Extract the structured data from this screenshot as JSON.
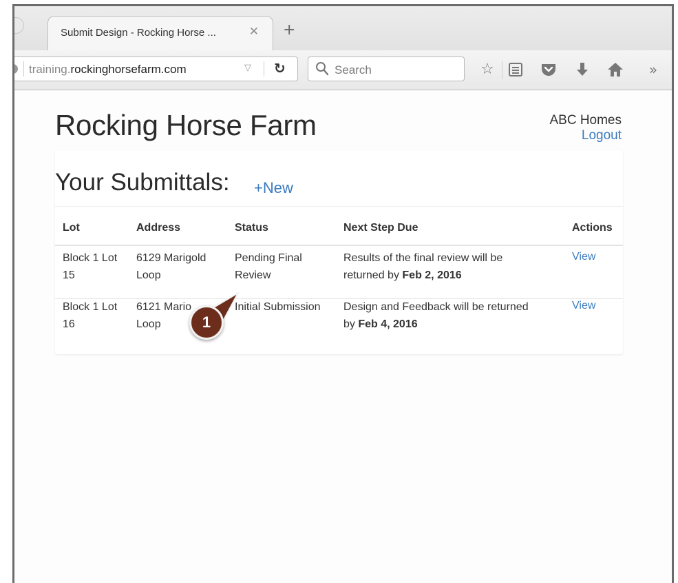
{
  "browser": {
    "tab_title": "Submit Design - Rocking Horse ...",
    "tab_close_glyph": "✕",
    "new_tab_glyph": "+",
    "url_prefix": "training.",
    "url_domain": "rockinghorsefarm.com",
    "search_placeholder": "Search",
    "toolbar_icons": [
      "bookmark-star-icon",
      "reading-list-icon",
      "pocket-icon",
      "download-icon",
      "home-icon",
      "overflow-chevron-icon"
    ]
  },
  "header": {
    "site_title": "Rocking Horse Farm",
    "user_name": "ABC Homes",
    "logout_label": "Logout"
  },
  "submittals": {
    "heading": "Your Submittals:",
    "new_label": "+New",
    "columns": [
      "Lot",
      "Address",
      "Status",
      "Next Step Due",
      "Actions"
    ],
    "rows": [
      {
        "lot_line1": "Block 1 Lot",
        "lot_line2": "15",
        "address_line1": "6129 Marigold",
        "address_line2": "Loop",
        "status_line1": "Pending Final",
        "status_line2": "Review",
        "next_step_line1": "Results of the final review will be",
        "next_step_line2_prefix": "returned by ",
        "next_step_date": "Feb 2, 2016",
        "action_label": "View"
      },
      {
        "lot_line1": "Block 1 Lot",
        "lot_line2": "16",
        "address_line1": "6121 Mario",
        "address_line2": "Loop",
        "status_line1": "Initial Submission",
        "status_line2": "",
        "next_step_line1": "Design and Feedback will be returned",
        "next_step_line2_prefix": "by ",
        "next_step_date": "Feb 4, 2016",
        "action_label": "View"
      }
    ]
  },
  "annotation": {
    "number": "1",
    "color": "#6d2d1c"
  },
  "colors": {
    "link": "#3a7bbf",
    "text": "#333333"
  }
}
